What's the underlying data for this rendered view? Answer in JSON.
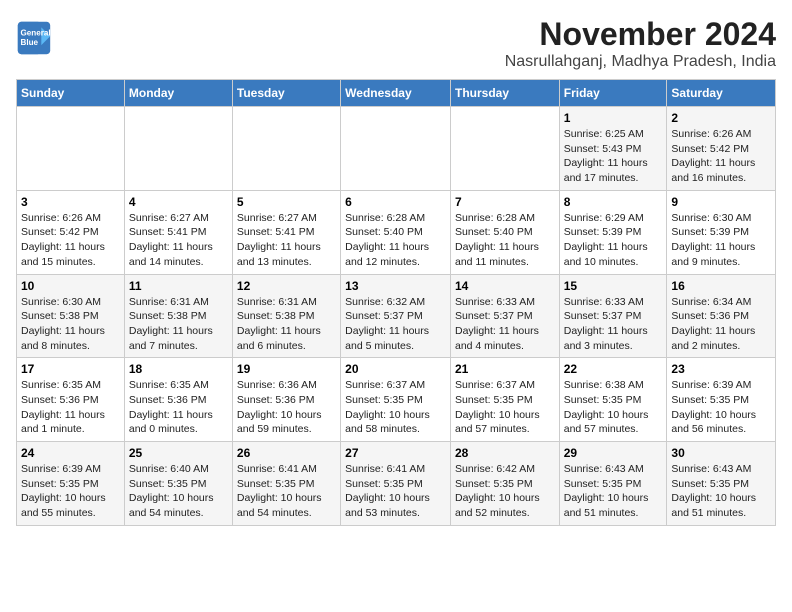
{
  "logo": {
    "line1": "General",
    "line2": "Blue"
  },
  "title": "November 2024",
  "location": "Nasrullahganj, Madhya Pradesh, India",
  "days_of_week": [
    "Sunday",
    "Monday",
    "Tuesday",
    "Wednesday",
    "Thursday",
    "Friday",
    "Saturday"
  ],
  "weeks": [
    [
      {
        "day": "",
        "info": ""
      },
      {
        "day": "",
        "info": ""
      },
      {
        "day": "",
        "info": ""
      },
      {
        "day": "",
        "info": ""
      },
      {
        "day": "",
        "info": ""
      },
      {
        "day": "1",
        "info": "Sunrise: 6:25 AM\nSunset: 5:43 PM\nDaylight: 11 hours and 17 minutes."
      },
      {
        "day": "2",
        "info": "Sunrise: 6:26 AM\nSunset: 5:42 PM\nDaylight: 11 hours and 16 minutes."
      }
    ],
    [
      {
        "day": "3",
        "info": "Sunrise: 6:26 AM\nSunset: 5:42 PM\nDaylight: 11 hours and 15 minutes."
      },
      {
        "day": "4",
        "info": "Sunrise: 6:27 AM\nSunset: 5:41 PM\nDaylight: 11 hours and 14 minutes."
      },
      {
        "day": "5",
        "info": "Sunrise: 6:27 AM\nSunset: 5:41 PM\nDaylight: 11 hours and 13 minutes."
      },
      {
        "day": "6",
        "info": "Sunrise: 6:28 AM\nSunset: 5:40 PM\nDaylight: 11 hours and 12 minutes."
      },
      {
        "day": "7",
        "info": "Sunrise: 6:28 AM\nSunset: 5:40 PM\nDaylight: 11 hours and 11 minutes."
      },
      {
        "day": "8",
        "info": "Sunrise: 6:29 AM\nSunset: 5:39 PM\nDaylight: 11 hours and 10 minutes."
      },
      {
        "day": "9",
        "info": "Sunrise: 6:30 AM\nSunset: 5:39 PM\nDaylight: 11 hours and 9 minutes."
      }
    ],
    [
      {
        "day": "10",
        "info": "Sunrise: 6:30 AM\nSunset: 5:38 PM\nDaylight: 11 hours and 8 minutes."
      },
      {
        "day": "11",
        "info": "Sunrise: 6:31 AM\nSunset: 5:38 PM\nDaylight: 11 hours and 7 minutes."
      },
      {
        "day": "12",
        "info": "Sunrise: 6:31 AM\nSunset: 5:38 PM\nDaylight: 11 hours and 6 minutes."
      },
      {
        "day": "13",
        "info": "Sunrise: 6:32 AM\nSunset: 5:37 PM\nDaylight: 11 hours and 5 minutes."
      },
      {
        "day": "14",
        "info": "Sunrise: 6:33 AM\nSunset: 5:37 PM\nDaylight: 11 hours and 4 minutes."
      },
      {
        "day": "15",
        "info": "Sunrise: 6:33 AM\nSunset: 5:37 PM\nDaylight: 11 hours and 3 minutes."
      },
      {
        "day": "16",
        "info": "Sunrise: 6:34 AM\nSunset: 5:36 PM\nDaylight: 11 hours and 2 minutes."
      }
    ],
    [
      {
        "day": "17",
        "info": "Sunrise: 6:35 AM\nSunset: 5:36 PM\nDaylight: 11 hours and 1 minute."
      },
      {
        "day": "18",
        "info": "Sunrise: 6:35 AM\nSunset: 5:36 PM\nDaylight: 11 hours and 0 minutes."
      },
      {
        "day": "19",
        "info": "Sunrise: 6:36 AM\nSunset: 5:36 PM\nDaylight: 10 hours and 59 minutes."
      },
      {
        "day": "20",
        "info": "Sunrise: 6:37 AM\nSunset: 5:35 PM\nDaylight: 10 hours and 58 minutes."
      },
      {
        "day": "21",
        "info": "Sunrise: 6:37 AM\nSunset: 5:35 PM\nDaylight: 10 hours and 57 minutes."
      },
      {
        "day": "22",
        "info": "Sunrise: 6:38 AM\nSunset: 5:35 PM\nDaylight: 10 hours and 57 minutes."
      },
      {
        "day": "23",
        "info": "Sunrise: 6:39 AM\nSunset: 5:35 PM\nDaylight: 10 hours and 56 minutes."
      }
    ],
    [
      {
        "day": "24",
        "info": "Sunrise: 6:39 AM\nSunset: 5:35 PM\nDaylight: 10 hours and 55 minutes."
      },
      {
        "day": "25",
        "info": "Sunrise: 6:40 AM\nSunset: 5:35 PM\nDaylight: 10 hours and 54 minutes."
      },
      {
        "day": "26",
        "info": "Sunrise: 6:41 AM\nSunset: 5:35 PM\nDaylight: 10 hours and 54 minutes."
      },
      {
        "day": "27",
        "info": "Sunrise: 6:41 AM\nSunset: 5:35 PM\nDaylight: 10 hours and 53 minutes."
      },
      {
        "day": "28",
        "info": "Sunrise: 6:42 AM\nSunset: 5:35 PM\nDaylight: 10 hours and 52 minutes."
      },
      {
        "day": "29",
        "info": "Sunrise: 6:43 AM\nSunset: 5:35 PM\nDaylight: 10 hours and 51 minutes."
      },
      {
        "day": "30",
        "info": "Sunrise: 6:43 AM\nSunset: 5:35 PM\nDaylight: 10 hours and 51 minutes."
      }
    ]
  ]
}
